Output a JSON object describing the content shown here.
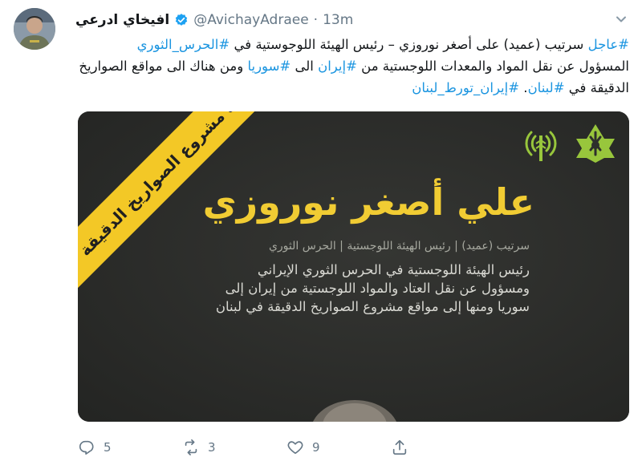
{
  "tweet": {
    "display_name": "افيخاي ادرعي",
    "handle": "@AvichayAdraee",
    "dot": "·",
    "time": "13m",
    "text_line1_parts": [
      {
        "text": "#عاجل",
        "hashtag": true
      },
      {
        "text": " سرتيب (عميد) على أصغر نوروزي – رئيس الهيئة اللوجوستية في ",
        "hashtag": false
      },
      {
        "text": "#الحرس_الثوري",
        "hashtag": true
      }
    ],
    "text_line2_parts": [
      {
        "text": "المسؤول عن نقل المواد والمعدات اللوجستية من ",
        "hashtag": false
      },
      {
        "text": "#إيران",
        "hashtag": true
      },
      {
        "text": " الى ",
        "hashtag": false
      },
      {
        "text": "#سوريا",
        "hashtag": true
      },
      {
        "text": " ومن هناك الى مواقع الصواريخ",
        "hashtag": false
      }
    ],
    "text_line3_parts": [
      {
        "text": "الدقيقة في ",
        "hashtag": false
      },
      {
        "text": "#لبنان",
        "hashtag": true
      },
      {
        "text": ". ",
        "hashtag": false
      },
      {
        "text": "#إيران_تورط_لبنان",
        "hashtag": true
      }
    ]
  },
  "media": {
    "band_text": "قادة مشروع الصواريخ الدقيقة",
    "name": "علي أصغر نوروزي",
    "rank_line": "سرتيب (عميد) | رئيس الهيئة اللوجستية | الحرس الثوري",
    "desc_lines": [
      "رئيس الهيئة اللوجستية في الحرس الثوري الإيراني",
      "ومسؤول عن نقل العتاد والمواد اللوجستية من إيران إلى",
      "سوريا ومنها إلى مواقع مشروع الصواريخ الدقيقة في لبنان"
    ]
  },
  "actions": {
    "reply_count": "5",
    "retweet_count": "3",
    "like_count": "9"
  },
  "colors": {
    "hashtag": "#1b95e0",
    "verified": "#1da1f2",
    "band": "#f3c826",
    "name": "#f1cc33",
    "media_bg": "#2e2f2c"
  },
  "icons": [
    "verified-badge-icon",
    "chevron-down-icon",
    "reply-icon",
    "retweet-icon",
    "like-icon",
    "share-icon",
    "idf-star-logo-icon",
    "intelligence-antenna-logo-icon"
  ]
}
